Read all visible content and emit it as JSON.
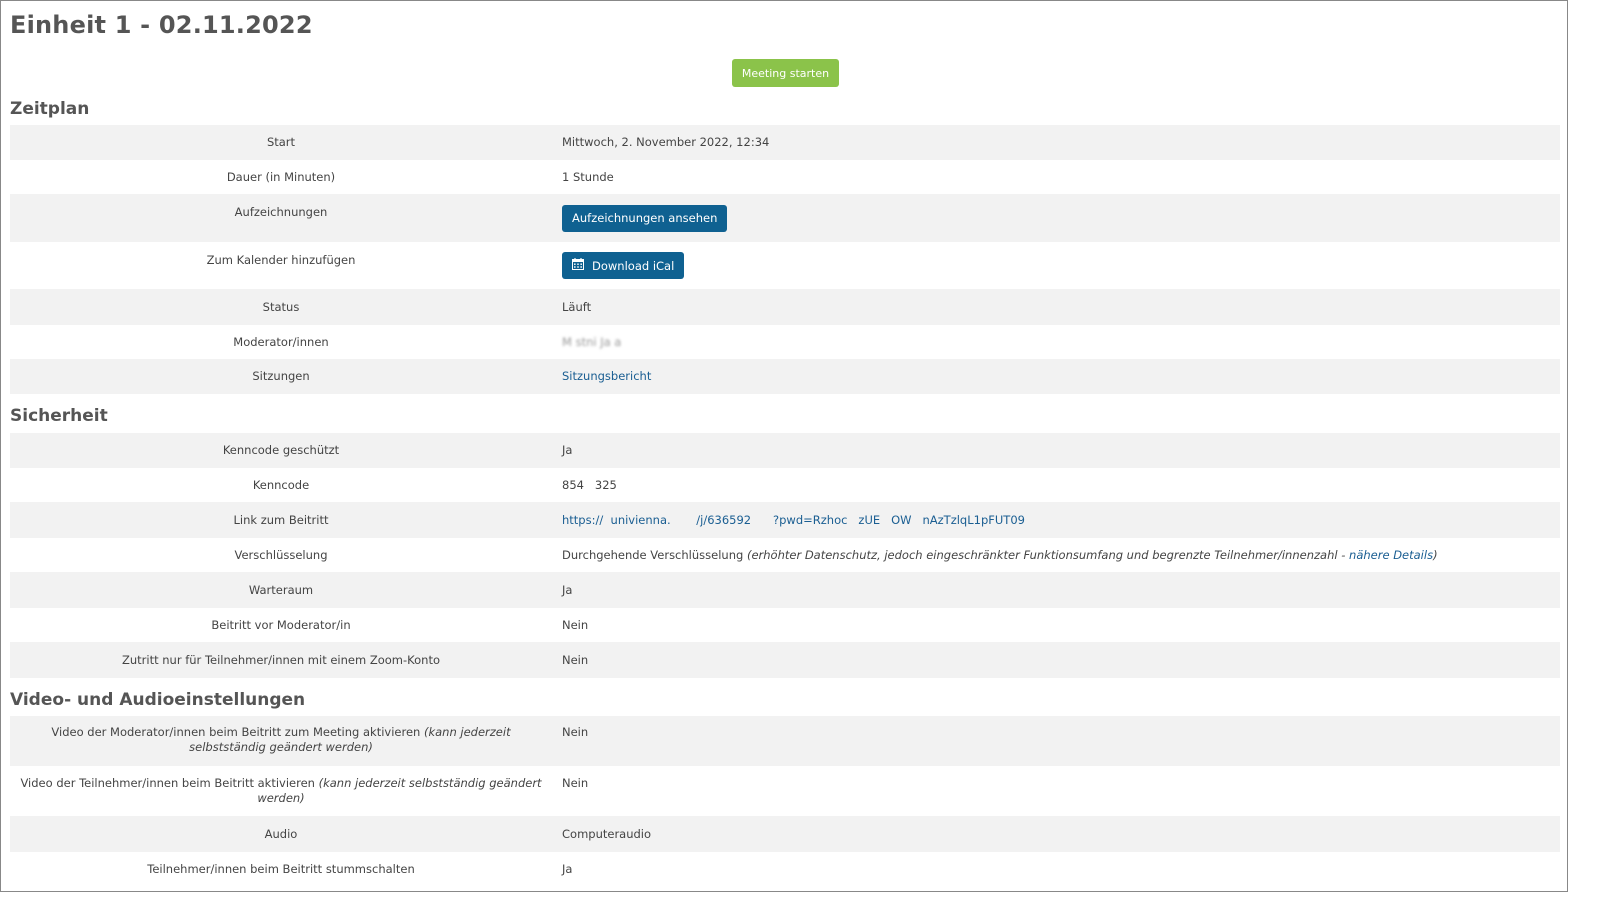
{
  "page_title": "Einheit 1 - 02.11.2022",
  "start_button": "Meeting starten",
  "sections": {
    "zeitplan": "Zeitplan",
    "sicherheit": "Sicherheit",
    "video_audio": "Video- und Audioeinstellungen"
  },
  "zeitplan": {
    "start_label": "Start",
    "start_value": "Mittwoch, 2. November 2022, 12:34",
    "dauer_label": "Dauer (in Minuten)",
    "dauer_value": "1 Stunde",
    "aufz_label": "Aufzeichnungen",
    "aufz_button": "Aufzeichnungen ansehen",
    "kal_label": "Zum Kalender hinzufügen",
    "kal_button": "Download iCal",
    "status_label": "Status",
    "status_value": "Läuft",
    "mod_label": "Moderator/innen",
    "mod_value": "M  stni Ja   a",
    "sitz_label": "Sitzungen",
    "sitz_link": "Sitzungsbericht"
  },
  "sicherheit": {
    "kenncode_geschuetzt_label": "Kenncode geschützt",
    "kenncode_geschuetzt_value": "Ja",
    "kenncode_label": "Kenncode",
    "kenncode_value": "854   325",
    "link_label": "Link zum Beitritt",
    "link_value": "https://  univienna.       /j/636592      ?pwd=Rzhoc   zUE   OW   nAzTzlqL1pFUT09",
    "versch_label": "Verschlüsselung",
    "versch_value": "Durchgehende Verschlüsselung",
    "versch_note": "(erhöhter Datenschutz, jedoch eingeschränkter Funktionsumfang und begrenzte Teilnehmer/innenzahl - ",
    "versch_link": "nähere Details",
    "versch_close": ")",
    "warteraum_label": "Warteraum",
    "warteraum_value": "Ja",
    "beitritt_label": "Beitritt vor Moderator/in",
    "beitritt_value": "Nein",
    "zutritt_label": "Zutritt nur für Teilnehmer/innen mit einem Zoom-Konto",
    "zutritt_value": "Nein"
  },
  "video_audio": {
    "vmod_label": "Video der Moderator/innen beim Beitritt zum Meeting aktivieren ",
    "vmod_note": "(kann jederzeit selbstständig geändert werden)",
    "vmod_value": "Nein",
    "vteil_label": "Video der Teilnehmer/innen beim Beitritt aktivieren ",
    "vteil_note": "(kann jederzeit selbstständig geändert werden)",
    "vteil_value": "Nein",
    "audio_label": "Audio",
    "audio_value": "Computeraudio",
    "mute_label": "Teilnehmer/innen beim Beitritt stummschalten",
    "mute_value": "Ja"
  }
}
